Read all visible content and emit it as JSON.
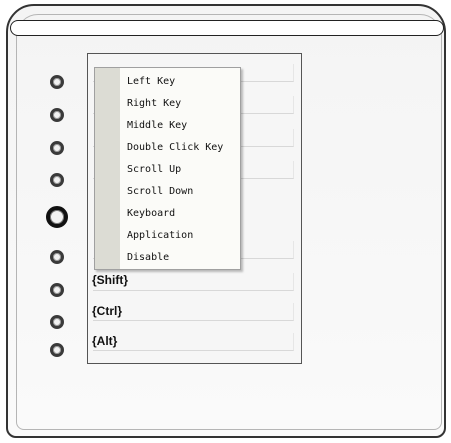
{
  "context_menu": {
    "items": [
      {
        "label": "Left Key"
      },
      {
        "label": "Right Key"
      },
      {
        "label": "Middle Key"
      },
      {
        "label": "Double Click Key"
      },
      {
        "label": "Scroll Up"
      },
      {
        "label": "Scroll Down"
      },
      {
        "label": "Keyboard"
      },
      {
        "label": "Application"
      },
      {
        "label": "Disable"
      }
    ]
  },
  "key_assignments": {
    "shift": "{Shift}",
    "ctrl": "{Ctrl}",
    "alt": "{Alt}"
  },
  "colors": {
    "device_border": "#333333",
    "menu_background": "#fbfbf8",
    "menu_gutter": "#dcdcd4"
  }
}
